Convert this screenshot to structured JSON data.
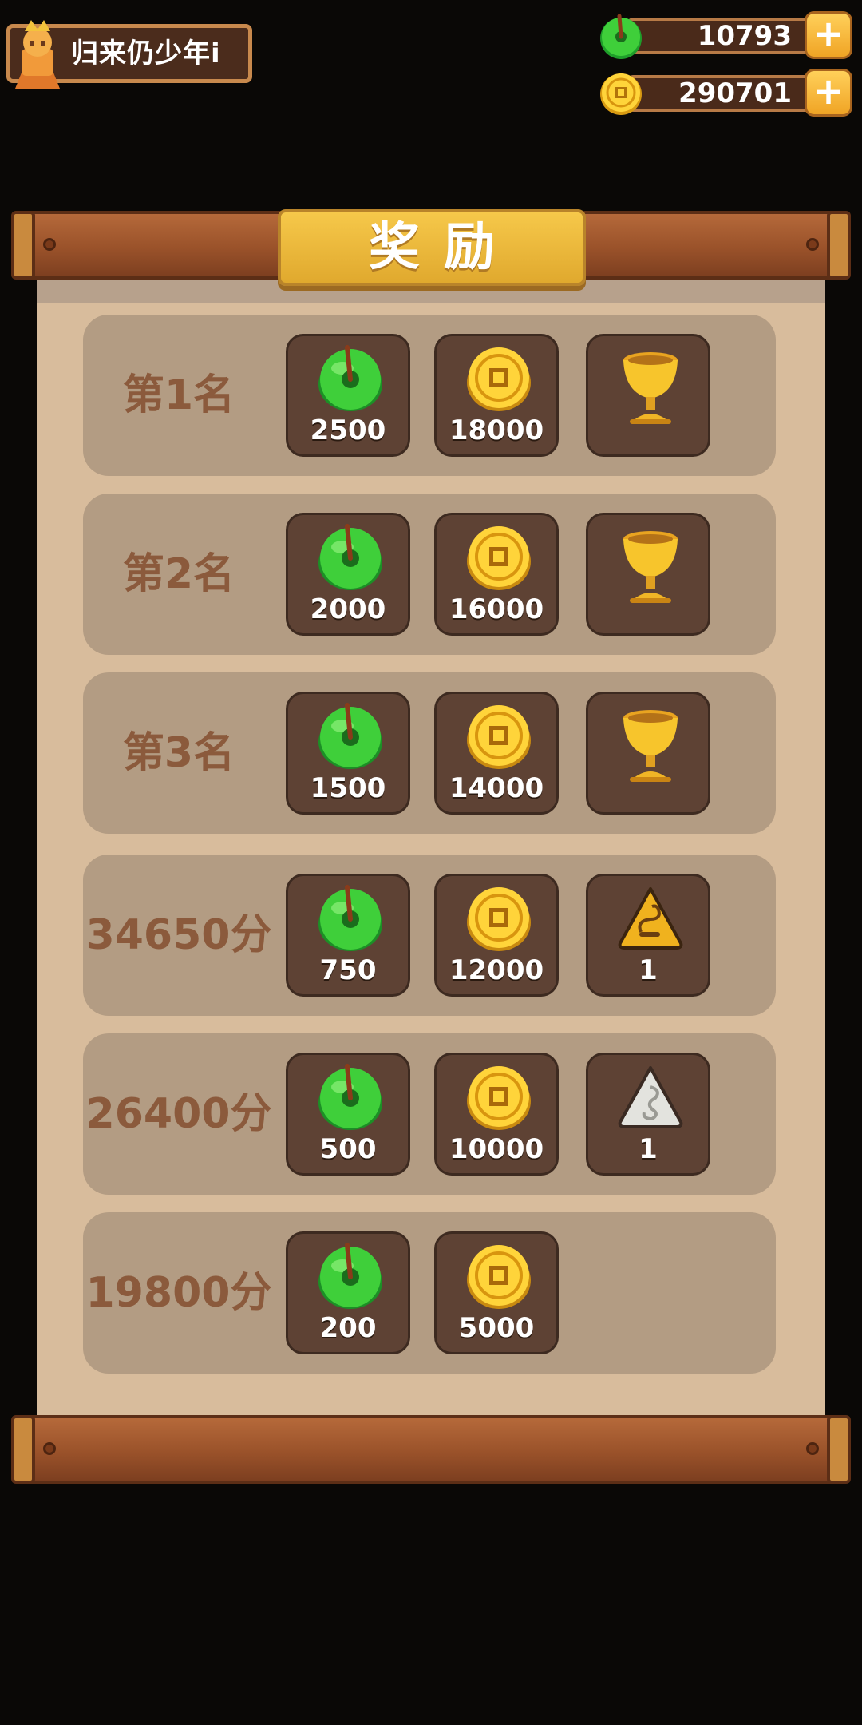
{
  "player": {
    "name": "归来仍少年i"
  },
  "currencies": {
    "jade": {
      "amount": "10793",
      "icon": "jade-icon"
    },
    "coin": {
      "amount": "290701",
      "icon": "coin-icon"
    }
  },
  "title": "奖励",
  "rows": [
    {
      "label": "第1名",
      "jade": "2500",
      "coin": "18000",
      "third": {
        "icon": "trophy-icon",
        "qty": ""
      }
    },
    {
      "label": "第2名",
      "jade": "2000",
      "coin": "16000",
      "third": {
        "icon": "trophy-icon",
        "qty": ""
      }
    },
    {
      "label": "第3名",
      "jade": "1500",
      "coin": "14000",
      "third": {
        "icon": "trophy-icon",
        "qty": ""
      }
    },
    {
      "label": "34650分",
      "jade": "750",
      "coin": "12000",
      "third": {
        "icon": "gold-charm-icon",
        "qty": "1"
      }
    },
    {
      "label": "26400分",
      "jade": "500",
      "coin": "10000",
      "third": {
        "icon": "silver-charm-icon",
        "qty": "1"
      }
    },
    {
      "label": "19800分",
      "jade": "200",
      "coin": "5000"
    }
  ]
}
